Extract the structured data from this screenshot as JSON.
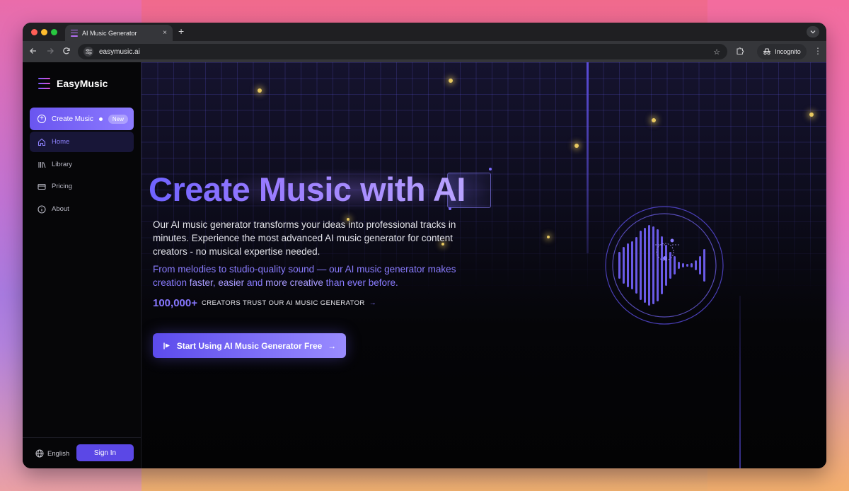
{
  "browser": {
    "tab_title": "AI Music Generator",
    "tab_close": "×",
    "new_tab": "+",
    "url": "easymusic.ai",
    "incognito_label": "Incognito"
  },
  "sidebar": {
    "brand": "EasyMusic",
    "create_label": "Create Music",
    "create_badge": "New",
    "items": [
      {
        "label": "Home",
        "icon": "home-icon"
      },
      {
        "label": "Library",
        "icon": "library-icon"
      },
      {
        "label": "Pricing",
        "icon": "card-icon"
      },
      {
        "label": "About",
        "icon": "info-icon"
      }
    ],
    "language": "English",
    "signin_label": "Sign In"
  },
  "hero": {
    "title_part1": "Create Music with ",
    "title_part2": "AI",
    "description": "Our AI music generator transforms your ideas into professional tracks in minutes. Experience the most advanced AI music generator for content creators - no musical expertise needed.",
    "tagline_start": "From melodies to studio-quality sound — our AI music generator makes creation ",
    "tagline_hl1": "faster",
    "tagline_sep1": ", ",
    "tagline_hl2": "easier",
    "tagline_sep2": " and ",
    "tagline_hl3": "more creative",
    "tagline_end": " than ever before.",
    "stat_number": "100,000+",
    "stat_label": "CREATORS TRUST OUR AI MUSIC GENERATOR",
    "cta_label": "Start Using AI Music Generator Free"
  },
  "colors": {
    "accent": "#6a55f0",
    "accent_light": "#8d7bff",
    "highlight": "#a99bff"
  }
}
